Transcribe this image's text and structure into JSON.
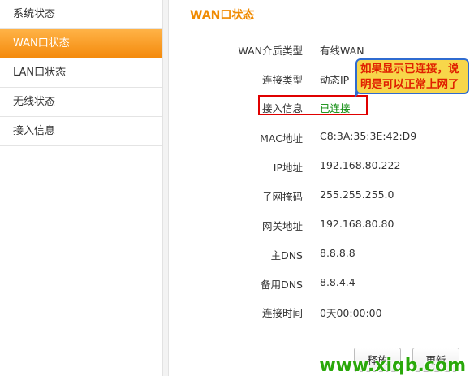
{
  "sidebar": {
    "items": [
      {
        "label": "系统状态",
        "active": false
      },
      {
        "label": "WAN口状态",
        "active": true
      },
      {
        "label": "LAN口状态",
        "active": false
      },
      {
        "label": "无线状态",
        "active": false
      },
      {
        "label": "接入信息",
        "active": false
      }
    ]
  },
  "main": {
    "title": "WAN口状态",
    "rows": [
      {
        "label": "WAN介质类型",
        "value": "有线WAN"
      },
      {
        "label": "连接类型",
        "value": "动态IP"
      },
      {
        "label": "接入信息",
        "value": "已连接"
      },
      {
        "label": "MAC地址",
        "value": "C8:3A:35:3E:42:D9"
      },
      {
        "label": "IP地址",
        "value": "192.168.80.222"
      },
      {
        "label": "子网掩码",
        "value": "255.255.255.0"
      },
      {
        "label": "网关地址",
        "value": "192.168.80.80"
      },
      {
        "label": "主DNS",
        "value": "8.8.8.8"
      },
      {
        "label": "备用DNS",
        "value": "8.8.4.4"
      },
      {
        "label": "连接时间",
        "value": "0天00:00:00"
      }
    ],
    "buttons": {
      "release": "释放",
      "renew": "更新"
    }
  },
  "annotation": {
    "callout_text": "如果显示已连接，说明是可以正常上网了"
  },
  "watermark": "www.xiqb.com",
  "colors": {
    "accent": "#f48a0c",
    "title": "#f08a00",
    "connected": "#0a8a0a",
    "callout_bg": "#f7d64a",
    "callout_text": "#e02000",
    "highlight": "#e00000"
  }
}
